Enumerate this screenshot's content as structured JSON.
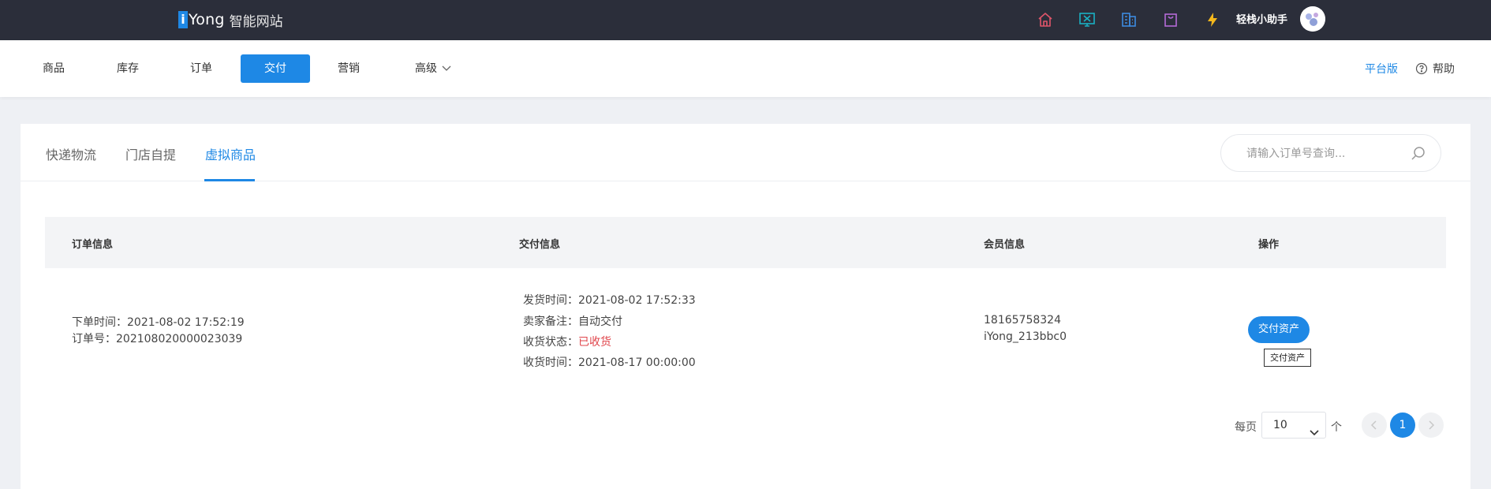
{
  "brand": {
    "logo_i": "i",
    "logo_text": "Yong",
    "logo_sub": "智能网站"
  },
  "topbar": {
    "icons": [
      "home-icon",
      "monitor-icon",
      "building-icon",
      "bag-icon",
      "lightning-icon"
    ],
    "assistant_label": "轻栈小助手"
  },
  "nav": {
    "items": [
      {
        "label": "商品"
      },
      {
        "label": "库存"
      },
      {
        "label": "订单"
      },
      {
        "label": "交付"
      },
      {
        "label": "营销"
      },
      {
        "label": "高级"
      }
    ],
    "active": "交付",
    "platform_label": "平台版",
    "help_label": "帮助"
  },
  "tabs": {
    "items": [
      {
        "label": "快递物流"
      },
      {
        "label": "门店自提"
      },
      {
        "label": "虚拟商品"
      }
    ],
    "active": "虚拟商品"
  },
  "search": {
    "placeholder": "请输入订单号查询..."
  },
  "table": {
    "headers": {
      "order_info": "订单信息",
      "delivery_info": "交付信息",
      "member_info": "会员信息",
      "actions": "操作"
    },
    "row": {
      "order_time": "下单时间：2021-08-02 17:52:19",
      "order_no": "订单号：202108020000023039",
      "ship_time_label": "发货时间：",
      "ship_time": "2021-08-02 17:52:33",
      "seller_note_label": "卖家备注：",
      "seller_note": "自动交付",
      "receive_status_label": "收货状态：",
      "receive_status": "已收货",
      "receive_time_label": "收货时间：",
      "receive_time": "2021-08-17 00:00:00",
      "member_phone": "18165758324",
      "member_name": "iYong_213bbc0",
      "action_button": "交付资产",
      "action_tooltip": "交付资产"
    }
  },
  "pagination": {
    "per_page_label": "每页",
    "per_page_value": "10",
    "unit_label": "个",
    "current_page": "1"
  },
  "colors": {
    "accent": "#1e88e5",
    "topbar": "#2b2e3a",
    "status_red": "#e0454b"
  }
}
